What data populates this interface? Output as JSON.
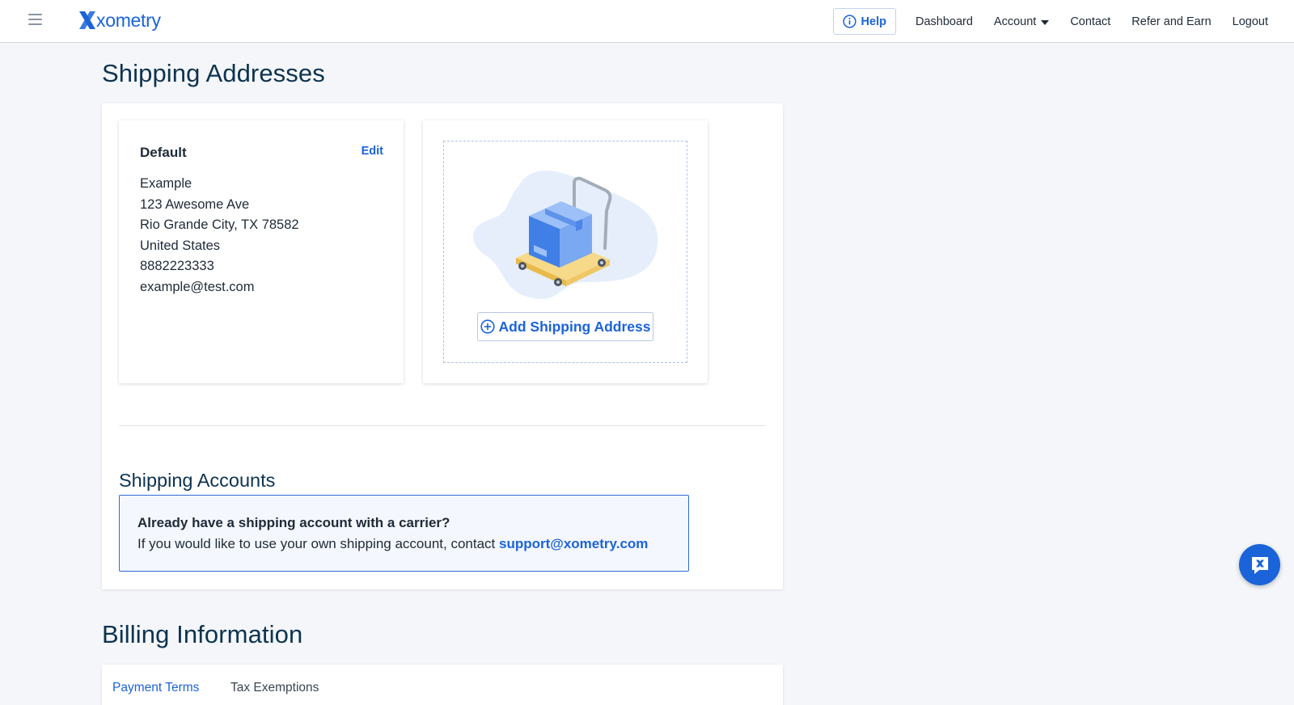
{
  "header": {
    "logo_text": "xometry",
    "help_label": "Help",
    "nav": {
      "dashboard": "Dashboard",
      "account": "Account",
      "contact": "Contact",
      "refer": "Refer and Earn",
      "logout": "Logout"
    }
  },
  "shipping": {
    "title": "Shipping Addresses",
    "default_card": {
      "title": "Default",
      "edit_label": "Edit",
      "lines": [
        "Example",
        "123 Awesome Ave",
        "Rio Grande City, TX 78582",
        "United States",
        "8882223333",
        "example@test.com"
      ]
    },
    "add_label": "Add Shipping Address"
  },
  "shipping_accounts": {
    "title": "Shipping Accounts",
    "notice_title": "Already have a shipping account with a carrier?",
    "notice_body": "If you would like to use your own shipping account, contact",
    "notice_link": "support@xometry.com"
  },
  "billing": {
    "title": "Billing Information",
    "tabs": [
      "Payment Terms",
      "Tax Exemptions"
    ],
    "active_tab": "Payment Terms"
  },
  "colors": {
    "brand": "#1b63d8",
    "heading": "#0d3350",
    "page_bg": "#f4f6f9"
  },
  "icons": {
    "menu": "hamburger-menu-icon",
    "help": "info-icon",
    "account_dropdown": "caret-down-icon",
    "add": "plus-circle-icon",
    "chat": "chat-bubble-icon"
  }
}
